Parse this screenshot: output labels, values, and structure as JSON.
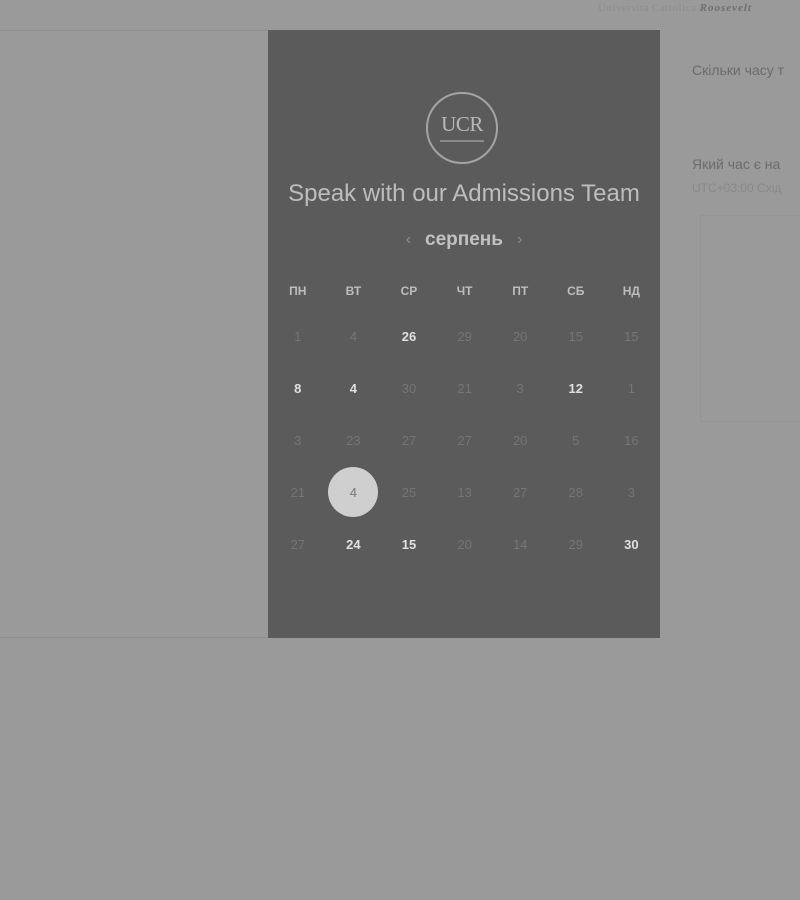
{
  "header": {
    "brand_prefix": "Universita Cattolica",
    "brand_name": "Roosevelt"
  },
  "right_panel": {
    "question1": "Скільки часу т",
    "question2": "Який час є на",
    "timezone": "UTC+03:00 Схід"
  },
  "modal": {
    "logo_text": "UCR",
    "title": "Speak with our Admissions Team",
    "month": "серпень",
    "prev_icon": "chevron-left-icon",
    "next_icon": "chevron-right-icon",
    "weekdays": [
      "ПН",
      "ВТ",
      "СР",
      "ЧТ",
      "ПТ",
      "СБ",
      "НД"
    ],
    "weeks": [
      [
        {
          "d": "1",
          "a": false
        },
        {
          "d": "4",
          "a": false
        },
        {
          "d": "26",
          "a": true
        },
        {
          "d": "29",
          "a": false
        },
        {
          "d": "20",
          "a": false
        },
        {
          "d": "15",
          "a": false
        },
        {
          "d": "15",
          "a": false
        }
      ],
      [
        {
          "d": "8",
          "a": true
        },
        {
          "d": "4",
          "a": true
        },
        {
          "d": "30",
          "a": false
        },
        {
          "d": "21",
          "a": false
        },
        {
          "d": "3",
          "a": false
        },
        {
          "d": "12",
          "a": true
        },
        {
          "d": "1",
          "a": false
        }
      ],
      [
        {
          "d": "3",
          "a": false
        },
        {
          "d": "23",
          "a": false
        },
        {
          "d": "27",
          "a": false
        },
        {
          "d": "27",
          "a": false
        },
        {
          "d": "20",
          "a": false
        },
        {
          "d": "5",
          "a": false
        },
        {
          "d": "16",
          "a": false
        }
      ],
      [
        {
          "d": "21",
          "a": false
        },
        {
          "d": "4",
          "a": false,
          "selected": true
        },
        {
          "d": "25",
          "a": false
        },
        {
          "d": "13",
          "a": false
        },
        {
          "d": "27",
          "a": false
        },
        {
          "d": "28",
          "a": false
        },
        {
          "d": "3",
          "a": false
        }
      ],
      [
        {
          "d": "27",
          "a": false
        },
        {
          "d": "24",
          "a": true
        },
        {
          "d": "15",
          "a": true
        },
        {
          "d": "20",
          "a": false
        },
        {
          "d": "14",
          "a": false
        },
        {
          "d": "29",
          "a": false
        },
        {
          "d": "30",
          "a": true
        }
      ]
    ],
    "colors": {
      "panel_bg": "#5b5b5b",
      "overlay": "#9a9a9a",
      "selected": "#cfcfcf"
    }
  }
}
